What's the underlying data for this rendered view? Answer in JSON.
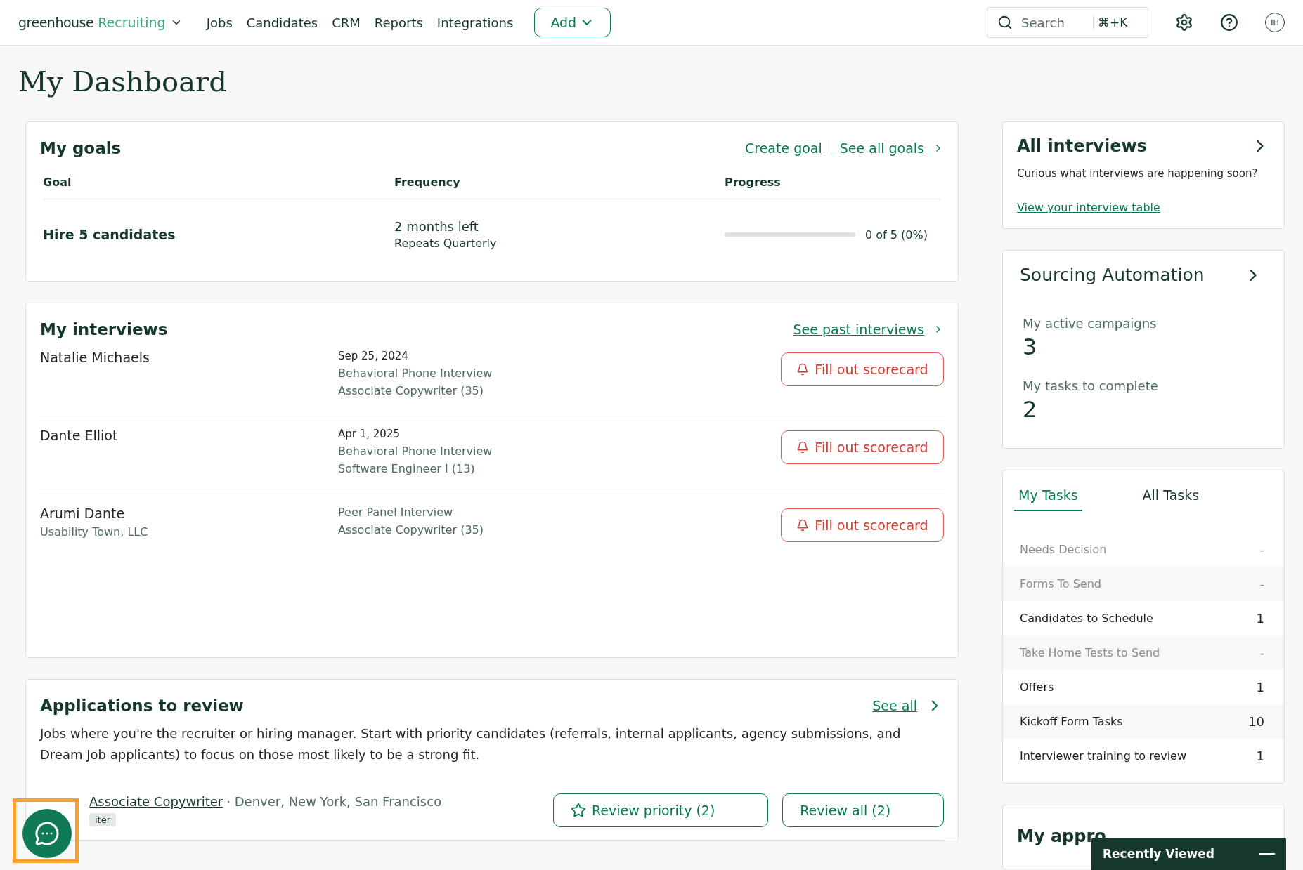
{
  "nav": {
    "logo_word": "greenhouse",
    "logo_product": "Recruiting",
    "items": [
      "Jobs",
      "Candidates",
      "CRM",
      "Reports",
      "Integrations"
    ],
    "add_button": "Add",
    "search": {
      "placeholder": "Search",
      "shortcut": "⌘+K"
    },
    "avatar": "IH"
  },
  "title": "My Dashboard",
  "goals": {
    "title": "My goals",
    "links": [
      "Create goal",
      "See all goals"
    ],
    "columns": [
      "Goal",
      "Frequency",
      "Progress"
    ],
    "rows": [
      {
        "goal": "Hire 5 candidates",
        "frequency": "2 months left",
        "repeat": "Repeats Quarterly",
        "level": 0,
        "reading": "0 of 5 (0%)"
      }
    ]
  },
  "interviews": {
    "title": "My interviews",
    "link": "See past interviews",
    "rows": [
      {
        "name": "Natalie Michaels",
        "lines": [
          "Sep 25, 2024",
          "Behavioral Phone Interview",
          "Associate Copywriter (35)"
        ],
        "button": "Fill out scorecard"
      },
      {
        "name": "Dante Elliot",
        "lines": [
          "Apr 1, 2025",
          "Behavioral Phone Interview",
          "Software Engineer I (13)"
        ],
        "button": "Fill out scorecard"
      },
      {
        "name": "Arumi Dante",
        "company": "Usability Town, LLC",
        "lines": [
          "Peer Panel Interview",
          "Associate Copywriter (35)"
        ],
        "button": "Fill out scorecard"
      }
    ]
  },
  "applications": {
    "title": "Applications to review",
    "link": "See all",
    "description": "Jobs where you're the recruiter or hiring manager. Start with priority candidates (referrals, internal applicants, agency submissions, and Dream Job applicants) to focus on those most likely to be a strong fit.",
    "jobs": [
      {
        "name": "Associate Copywriter",
        "locations": "· Denver, New York, San Francisco",
        "badge": "iter",
        "buttons": [
          "Review priority (2)",
          "Review all (2)"
        ]
      }
    ]
  },
  "all_interviews": {
    "title": "All interviews",
    "text": "Curious what interviews are happening soon?",
    "link": "View your interview table"
  },
  "sourcing": {
    "title": "Sourcing Automation",
    "stats": [
      {
        "label": "My active campaigns",
        "value": "3"
      },
      {
        "label": "My tasks to complete",
        "value": "2"
      }
    ]
  },
  "tasks": {
    "tabs": [
      {
        "label": "My Tasks",
        "selected": true
      },
      {
        "label": "All Tasks",
        "selected": false
      }
    ],
    "rows": [
      {
        "label": "Needs Decision",
        "count": "-",
        "disabled": true
      },
      {
        "label": "Forms To Send",
        "count": "-",
        "disabled": true
      },
      {
        "label": "Candidates to Schedule",
        "count": "1",
        "disabled": false
      },
      {
        "label": "Take Home Tests to Send",
        "count": "-",
        "disabled": true
      },
      {
        "label": "Offers",
        "count": "1",
        "disabled": false
      },
      {
        "label": "Kickoff Form Tasks",
        "count": "10",
        "disabled": false
      },
      {
        "label": "Interviewer training to review",
        "count": "1",
        "disabled": false
      }
    ]
  },
  "approvals": {
    "title": "My appro"
  },
  "recently_viewed": {
    "title": "Recently Viewed"
  }
}
